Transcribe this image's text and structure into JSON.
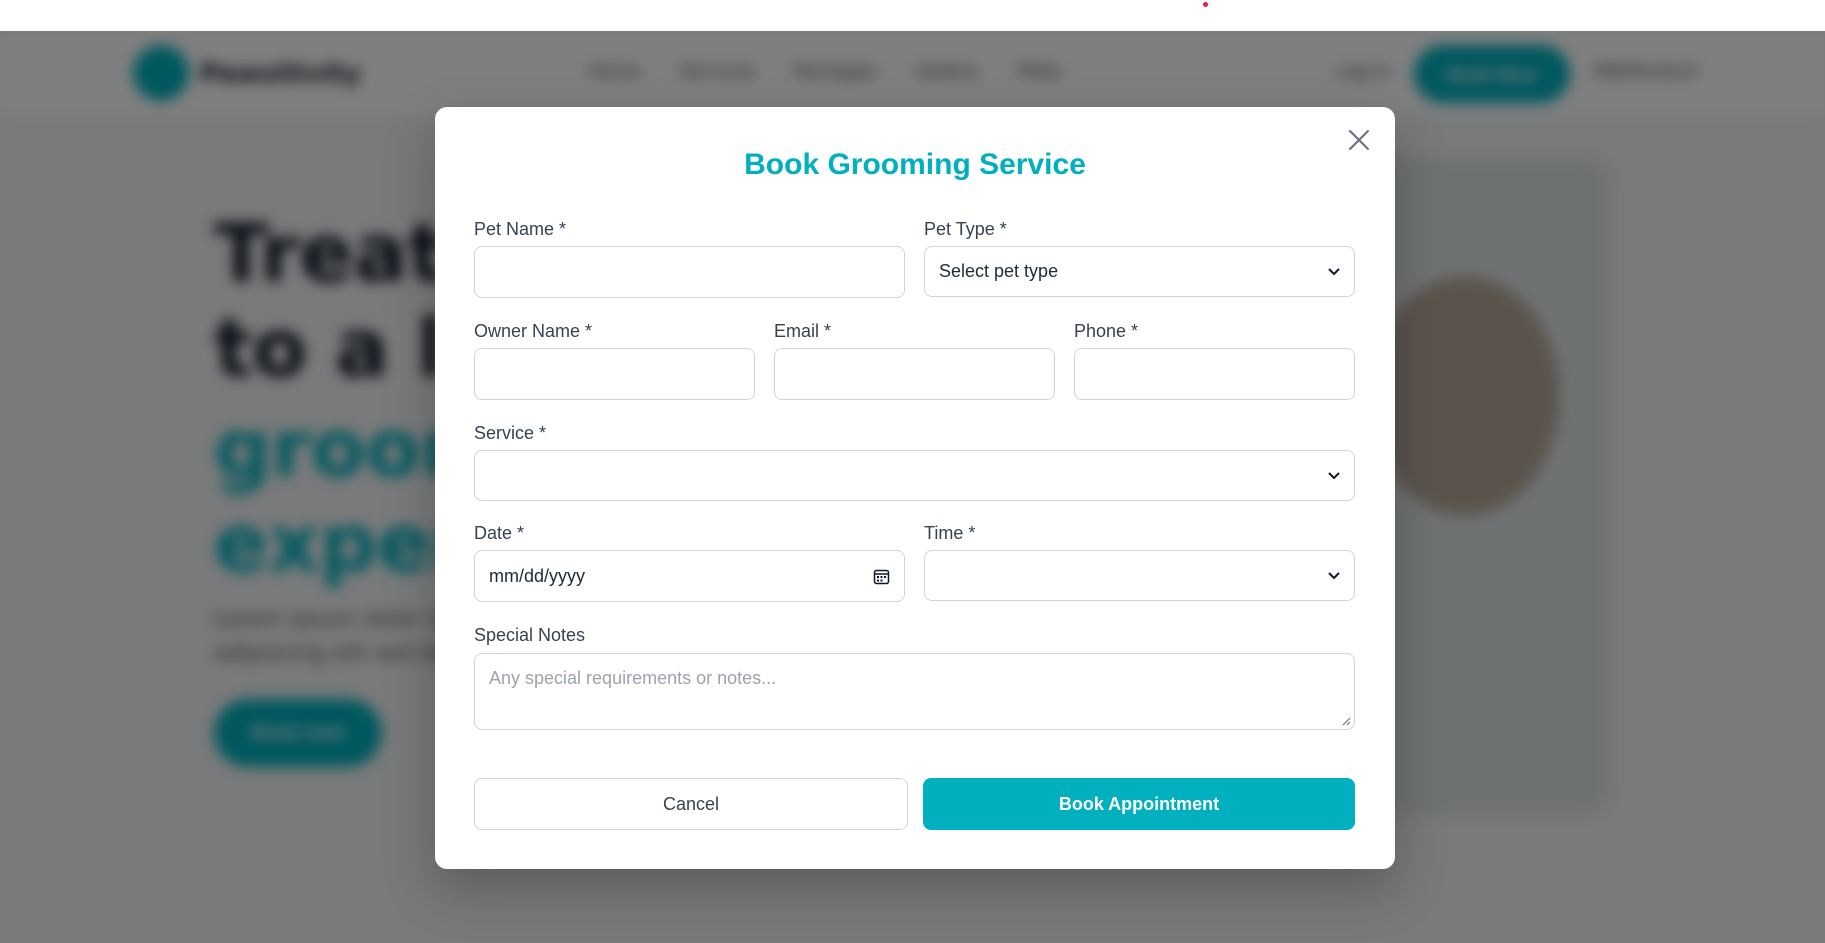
{
  "background_page": {
    "brand": "Pawsitivity",
    "nav_items": [
      "Home",
      "Services",
      "Packages",
      "Gallery",
      "FAQs"
    ],
    "login_label": "Log in",
    "header_cta": "Book Now",
    "language": "EN/Deutsch",
    "hero_title_line1": "Treat your pet",
    "hero_title_line2": "to a luxury",
    "hero_highlight_line1": "grooming",
    "hero_highlight_line2": "experience",
    "hero_text_line1": "Lorem ipsum dolor sit amet consectetur",
    "hero_text_line2": "adipiscing elit sed do eiusmod",
    "hero_cta": "Book now",
    "colors": {
      "accent": "#00b0be"
    }
  },
  "modal": {
    "title": "Book Grooming Service",
    "close_icon": "close-icon",
    "fields": {
      "pet_name": {
        "label": "Pet Name *",
        "value": ""
      },
      "pet_type": {
        "label": "Pet Type *",
        "value": "Select pet type"
      },
      "owner_name": {
        "label": "Owner Name *",
        "value": ""
      },
      "email": {
        "label": "Email *",
        "value": ""
      },
      "phone": {
        "label": "Phone *",
        "value": ""
      },
      "service": {
        "label": "Service *",
        "value": ""
      },
      "date": {
        "label": "Date *",
        "placeholder": "mm/dd/yyyy"
      },
      "time": {
        "label": "Time *",
        "value": ""
      },
      "notes": {
        "label": "Special Notes",
        "placeholder": "Any special requirements or notes..."
      }
    },
    "buttons": {
      "cancel": "Cancel",
      "submit": "Book Appointment"
    },
    "colors": {
      "accent": "#00b0be",
      "border": "#d1d5db",
      "label": "#374151"
    }
  }
}
